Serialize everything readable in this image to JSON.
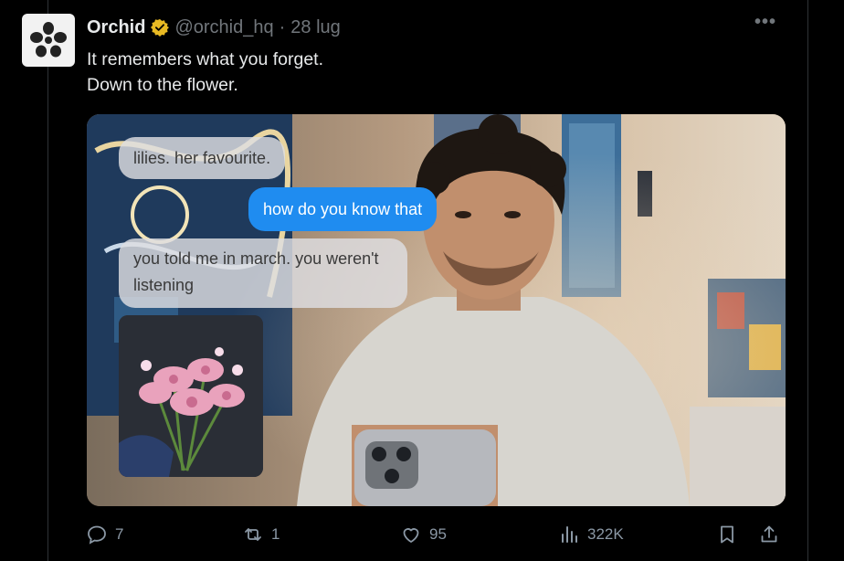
{
  "post": {
    "author_name": "Orchid",
    "handle": "@orchid_hq",
    "separator": "·",
    "date": "28 lug",
    "text_line1": "It remembers what you forget.",
    "text_line2": "Down to the flower.",
    "more": "•••"
  },
  "media": {
    "bubbles": {
      "msg1": "lilies. her favourite.",
      "msg2": "how do you know that",
      "msg3": "you told me in march. you weren't listening"
    }
  },
  "actions": {
    "replies": "7",
    "reposts": "1",
    "likes": "95",
    "views": "322K"
  },
  "colors": {
    "background": "#000000",
    "text": "#e7e9ea",
    "muted": "#71767b",
    "verified_badge": "#e8b923",
    "bubble_blue": "#1f8cf0"
  },
  "icons": [
    "orchid-logo-icon",
    "verified-badge-icon",
    "more-icon",
    "reply-icon",
    "repost-icon",
    "like-icon",
    "views-icon",
    "bookmark-icon",
    "share-icon"
  ]
}
